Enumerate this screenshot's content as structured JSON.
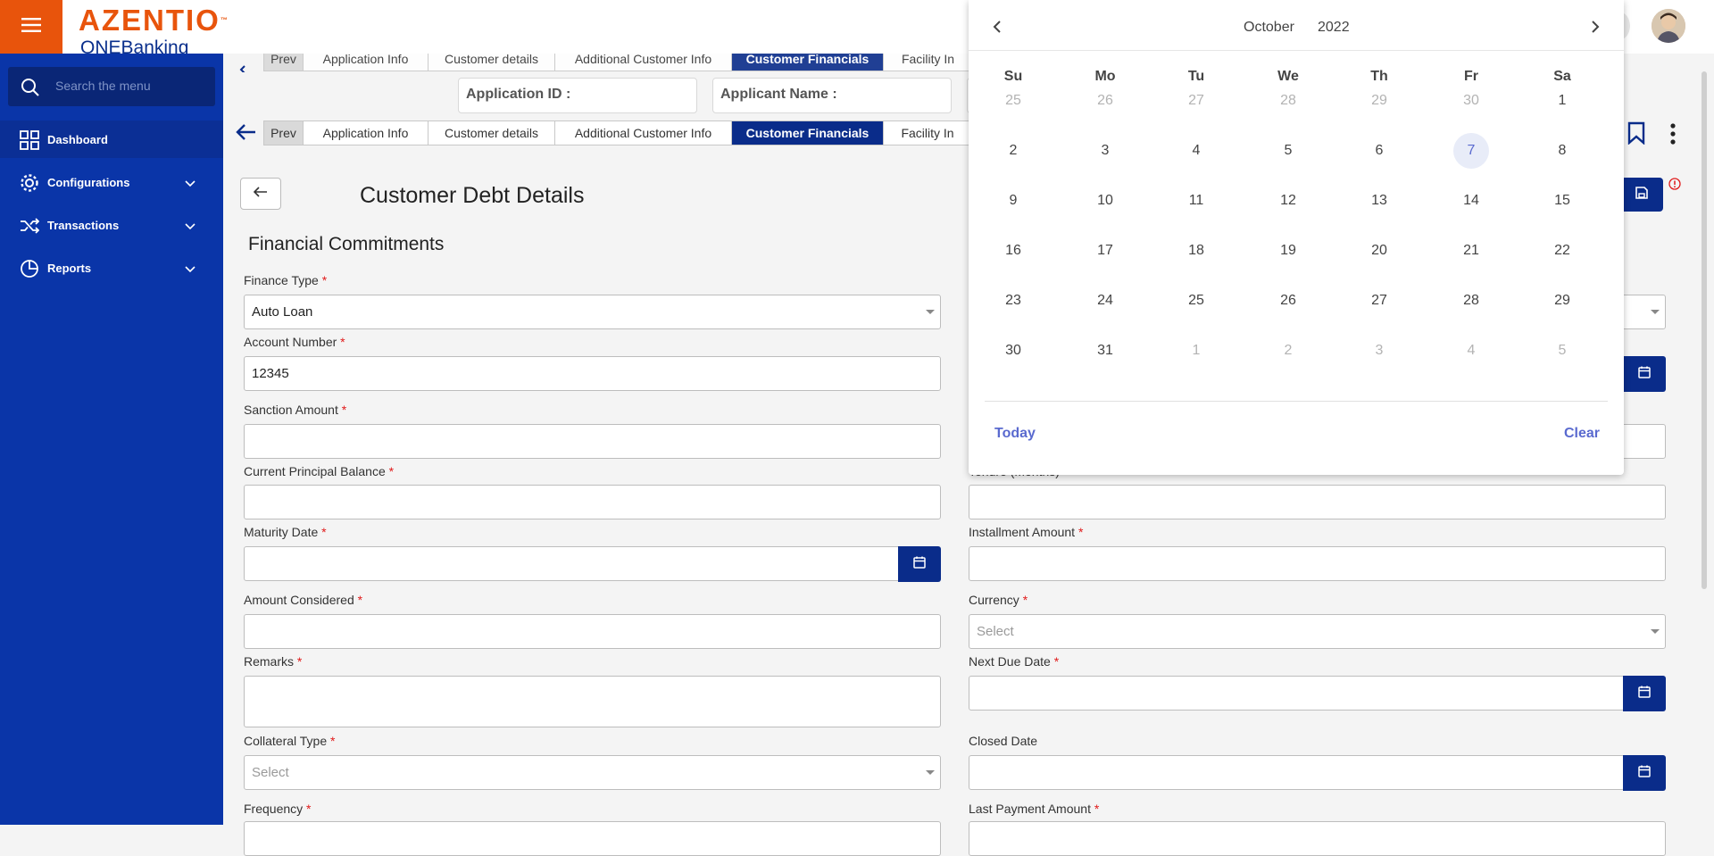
{
  "brand": {
    "name": "AZENTIO",
    "tm": "™",
    "sub": "ONEBanking"
  },
  "search": {
    "placeholder": "Search the menu"
  },
  "sidebar": {
    "items": [
      {
        "label": "Dashboard"
      },
      {
        "label": "Configurations"
      },
      {
        "label": "Transactions"
      },
      {
        "label": "Reports"
      }
    ]
  },
  "tabs": {
    "prev": "Prev",
    "items": [
      "Application Info",
      "Customer details",
      "Additional Customer Info",
      "Customer Financials",
      "Facility In"
    ]
  },
  "app_fields": {
    "application_id": "Application ID :",
    "applicant_name": "Applicant Name :"
  },
  "page": {
    "title": "Customer Debt Details",
    "section": "Financial Commitments"
  },
  "form": {
    "finance_type": {
      "label": "Finance Type",
      "value": "Auto Loan"
    },
    "account_number": {
      "label": "Account Number",
      "value": "12345"
    },
    "sanction_amount": {
      "label": "Sanction Amount",
      "value": ""
    },
    "current_principal_balance": {
      "label": "Current Principal Balance",
      "value": ""
    },
    "tenure": {
      "label": "Tenure (Months)",
      "value": ""
    },
    "maturity_date": {
      "label": "Maturity Date",
      "value": ""
    },
    "installment_amount": {
      "label": "Installment Amount",
      "value": ""
    },
    "amount_considered": {
      "label": "Amount Considered",
      "value": ""
    },
    "currency": {
      "label": "Currency",
      "placeholder": "Select"
    },
    "remarks": {
      "label": "Remarks",
      "value": ""
    },
    "next_due_date": {
      "label": "Next Due Date",
      "value": ""
    },
    "collateral_type": {
      "label": "Collateral Type",
      "placeholder": "Select"
    },
    "closed_date": {
      "label": "Closed Date",
      "value": ""
    },
    "frequency": {
      "label": "Frequency"
    },
    "last_payment_amount": {
      "label": "Last Payment Amount"
    },
    "required_mark": "*"
  },
  "calendar": {
    "month": "October",
    "year": "2022",
    "weekdays": [
      "Su",
      "Mo",
      "Tu",
      "We",
      "Th",
      "Fr",
      "Sa"
    ],
    "weeks": [
      [
        "25",
        "26",
        "27",
        "28",
        "29",
        "30",
        "1"
      ],
      [
        "2",
        "3",
        "4",
        "5",
        "6",
        "7",
        "8"
      ],
      [
        "9",
        "10",
        "11",
        "12",
        "13",
        "14",
        "15"
      ],
      [
        "16",
        "17",
        "18",
        "19",
        "20",
        "21",
        "22"
      ],
      [
        "23",
        "24",
        "25",
        "26",
        "27",
        "28",
        "29"
      ],
      [
        "30",
        "31",
        "1",
        "2",
        "3",
        "4",
        "5"
      ]
    ],
    "selected": "7",
    "today_label": "Today",
    "clear_label": "Clear"
  },
  "colors": {
    "brand_orange": "#e8540c",
    "sidebar_blue": "#0a35a8",
    "active_tab": "#0a2c8a",
    "required": "#e01a1a",
    "calendar_accent": "#5a6acf"
  }
}
